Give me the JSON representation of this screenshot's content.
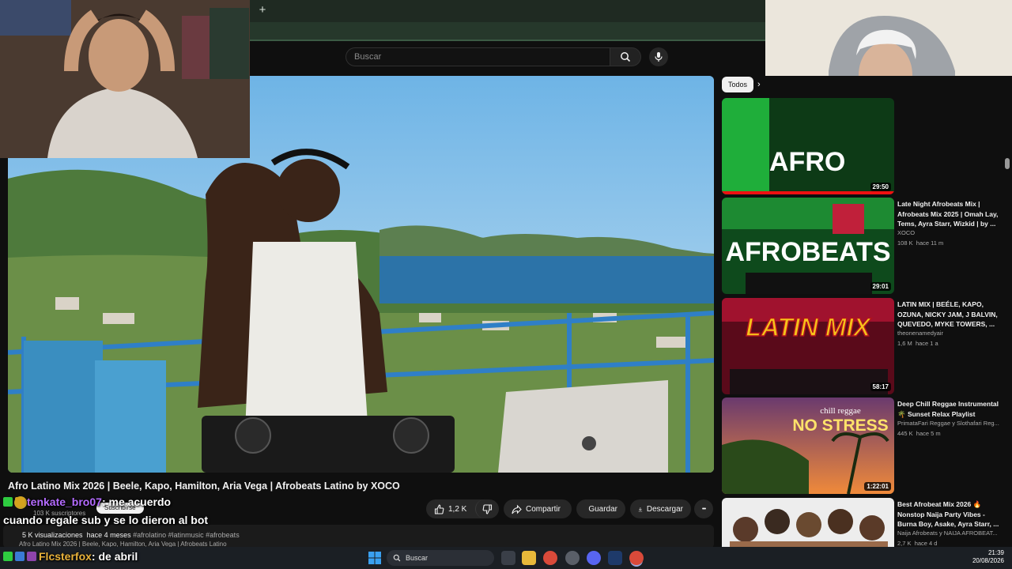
{
  "search": {
    "placeholder": "Buscar"
  },
  "browser": {
    "new_tab": "+"
  },
  "video": {
    "title": "Afro Latino Mix 2026 | Beele, Kapo, Hamilton, Aria Vega | Afrobeats Latino by XOCO",
    "subscribers": "103 K suscriptores",
    "subscribe": "Suscribirse",
    "likes": "1,2 K",
    "share": "Compartir",
    "save": "Guardar",
    "download": "Descargar",
    "more": "•••",
    "views": "5 K visualizaciones",
    "age": "hace 4 meses",
    "tags": "#afrolatino #latinmusic #afrobeats",
    "description": "Afro Latino Mix 2026 | Beele, Kapo, Hamilton, Aria Vega | Afrobeats Latino"
  },
  "chat": [
    {
      "user": "tenkate_bro07",
      "message": ": me acuerdo",
      "color": "#b46bff"
    },
    {
      "user": "",
      "message": "cuando regale sub y se lo dieron al bot",
      "color": "#ffffff"
    },
    {
      "user": "Flcsterfox",
      "message": ": de abril",
      "color": "#e8b23a"
    }
  ],
  "sidebar": {
    "chip_all": "Todos",
    "chip_next": "›",
    "items": [
      {
        "thumb_text": "AFRO",
        "duration": "29:50",
        "title": "",
        "channel": "",
        "views": "",
        "age": "",
        "accent": "#2fd24a"
      },
      {
        "thumb_text": "AFROBEATS",
        "duration": "29:01",
        "title": "Late Night Afrobeats Mix | Afrobeats Mix 2025 | Omah Lay, Tems, Ayra Starr, Wizkid | by ...",
        "channel": "XOCO",
        "views": "108 K",
        "age": "hace 11 m",
        "accent": "#2fd24a"
      },
      {
        "thumb_text": "LATIN MIX",
        "duration": "58:17",
        "title": "LATIN MIX | BEÉLE, KAPO, OZUNA, NICKY JAM, J BALVIN, QUEVEDO, MYKE TOWERS, ...",
        "channel": "theonenamedyair",
        "views": "1,6 M",
        "age": "hace 1 a",
        "accent": "#e0123a"
      },
      {
        "thumb_text": "NO STRESS",
        "thumb_sub": "chill reggae",
        "duration": "1:22:01",
        "title": "Deep Chill Reggae Instrumental 🌴 Sunset Relax Playlist",
        "channel": "PrimataFari Reggae y Slothafari Reg...",
        "views": "445 K",
        "age": "hace 5 m",
        "accent": "#f08a3a"
      },
      {
        "thumb_text": "",
        "duration": "",
        "title": "Best Afrobeat Mix 2026 🔥 Nonstop Naija Party Vibes - Burna Boy, Asake, Ayra Starr, ...",
        "channel": "Naija Afrobeats y NAIJA AFROBEAT...",
        "views": "2,7 K",
        "age": "hace 4 d",
        "accent": "#e6e6e6"
      }
    ]
  },
  "taskbar": {
    "search": "Buscar",
    "time": "21:39",
    "date": "20/08/2026"
  },
  "colors": {
    "background": "#0f0f0f",
    "chip": "#f1f1f1",
    "pill": "#272727"
  }
}
